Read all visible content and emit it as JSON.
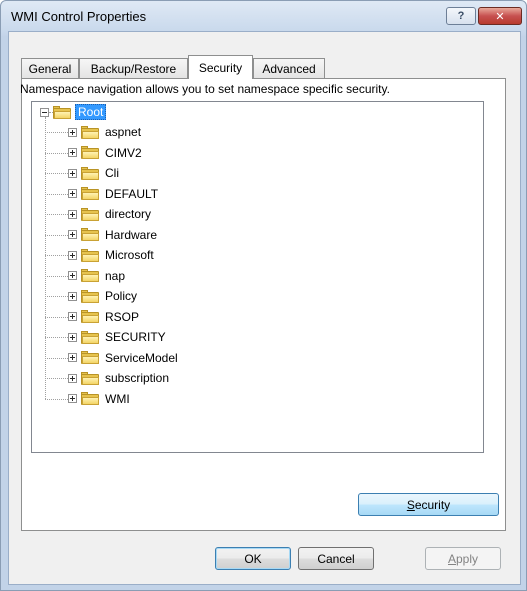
{
  "window": {
    "title": "WMI Control Properties",
    "help_label": "?",
    "close_label": "✕"
  },
  "tabs": [
    {
      "label": "General"
    },
    {
      "label": "Backup/Restore"
    },
    {
      "label": "Security"
    },
    {
      "label": "Advanced"
    }
  ],
  "active_tab": "Security",
  "description": "Namespace navigation allows you to set namespace specific security.",
  "tree": {
    "root": {
      "label": "Root",
      "expanded": true,
      "selected": true
    },
    "children": [
      {
        "label": "aspnet"
      },
      {
        "label": "CIMV2"
      },
      {
        "label": "Cli"
      },
      {
        "label": "DEFAULT"
      },
      {
        "label": "directory"
      },
      {
        "label": "Hardware"
      },
      {
        "label": "Microsoft"
      },
      {
        "label": "nap"
      },
      {
        "label": "Policy"
      },
      {
        "label": "RSOP"
      },
      {
        "label": "SECURITY"
      },
      {
        "label": "ServiceModel"
      },
      {
        "label": "subscription"
      },
      {
        "label": "WMI"
      }
    ]
  },
  "buttons": {
    "security_prefix": "S",
    "security_rest": "ecurity",
    "ok": "OK",
    "cancel": "Cancel",
    "apply_prefix": "A",
    "apply_rest": "pply"
  },
  "colors": {
    "selection": "#3399ff",
    "folder": "#e6c34e",
    "close_button": "#c75050"
  },
  "icons": [
    "help-icon",
    "close-icon",
    "folder-icon",
    "expand-icon",
    "collapse-icon"
  ]
}
